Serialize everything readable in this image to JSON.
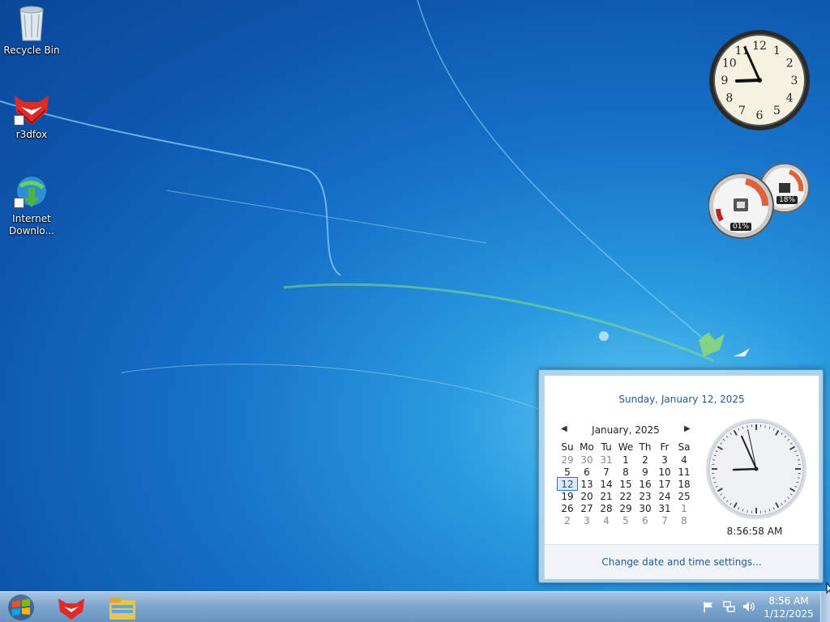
{
  "desktop": {
    "icons": [
      {
        "label": "Recycle Bin",
        "icon": "recycle-bin-icon"
      },
      {
        "label": "r3dfox",
        "icon": "r3dfox-icon"
      },
      {
        "label": "Internet\nDownlo...",
        "line1": "Internet",
        "line2": "Downlo...",
        "icon": "internet-download-manager-icon"
      }
    ]
  },
  "gadgets": {
    "clock": {
      "hour": 8,
      "minute": 56,
      "numbers": [
        "12",
        "1",
        "2",
        "3",
        "4",
        "5",
        "6",
        "7",
        "8",
        "9",
        "10",
        "11"
      ]
    },
    "cpu_meter": {
      "cpu_label": "01%",
      "memory_label": "18%",
      "cpu_value": 1,
      "memory_value": 18
    }
  },
  "flyout": {
    "date_long": "Sunday, January 12, 2025",
    "month_label": "January, 2025",
    "weekdays": [
      "Su",
      "Mo",
      "Tu",
      "We",
      "Th",
      "Fr",
      "Sa"
    ],
    "weeks": [
      [
        "29",
        "30",
        "31",
        "1",
        "2",
        "3",
        "4"
      ],
      [
        "5",
        "6",
        "7",
        "8",
        "9",
        "10",
        "11"
      ],
      [
        "12",
        "13",
        "14",
        "15",
        "16",
        "17",
        "18"
      ],
      [
        "19",
        "20",
        "21",
        "22",
        "23",
        "24",
        "25"
      ],
      [
        "26",
        "27",
        "28",
        "29",
        "30",
        "31",
        "1"
      ],
      [
        "2",
        "3",
        "4",
        "5",
        "6",
        "7",
        "8"
      ]
    ],
    "today": "12",
    "time": "8:56:58 AM",
    "settings_link": "Change date and time settings..."
  },
  "taskbar": {
    "time": "8:56 AM",
    "date": "1/12/2025",
    "pinned": [
      "r3dfox-icon",
      "file-explorer-icon"
    ],
    "tray": [
      "action-center-flag-icon",
      "network-icon",
      "volume-icon"
    ]
  },
  "colors": {
    "accent": "#1e5a99",
    "taskbar": "#7ea6cd",
    "desktop": "#1672c8"
  }
}
